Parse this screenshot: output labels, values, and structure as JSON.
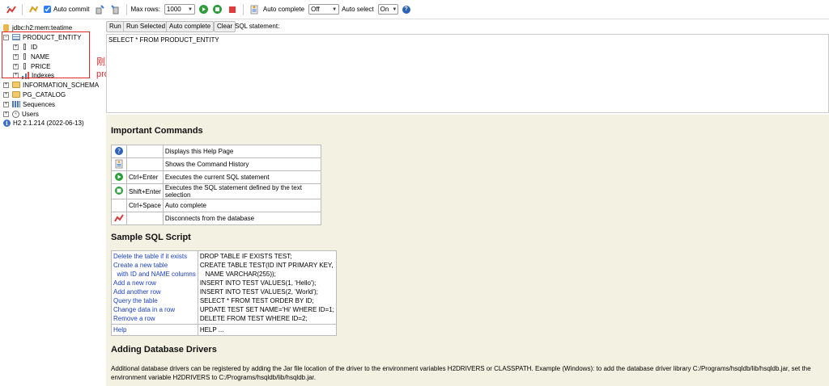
{
  "toolbar": {
    "auto_commit_label": "Auto commit",
    "max_rows_label": "Max rows:",
    "max_rows_value": "1000",
    "auto_complete_label": "Auto complete",
    "auto_complete_value": "Off",
    "auto_select_label": "Auto select",
    "auto_select_value": "On"
  },
  "tree": {
    "connection": "jdbc:h2:mem:teatime",
    "table": "PRODUCT_ENTITY",
    "columns": [
      "ID",
      "NAME",
      "PRICE"
    ],
    "indexes": "Indexes",
    "schemas": [
      "INFORMATION_SCHEMA",
      "PG_CATALOG"
    ],
    "sequences": "Sequences",
    "users": "Users",
    "version": "H2 2.1.214 (2022-06-13)"
  },
  "annotation": {
    "line1": "刚建立的",
    "line2": "product_entity"
  },
  "sql": {
    "buttons": [
      "Run",
      "Run Selected",
      "Auto complete",
      "Clear"
    ],
    "statement_label": "SQL statement:",
    "text": "SELECT * FROM PRODUCT_ENTITY"
  },
  "help": {
    "important_title": "Important Commands",
    "commands": [
      {
        "icon": "help-icon",
        "shortcut": "",
        "desc": "Displays this Help Page"
      },
      {
        "icon": "history-icon",
        "shortcut": "",
        "desc": "Shows the Command History"
      },
      {
        "icon": "run-icon",
        "shortcut": "Ctrl+Enter",
        "desc": "Executes the current SQL statement"
      },
      {
        "icon": "run-selected-icon",
        "shortcut": "Shift+Enter",
        "desc": "Executes the SQL statement defined by the text selection"
      },
      {
        "icon": "",
        "shortcut": "Ctrl+Space",
        "desc": "Auto complete"
      },
      {
        "icon": "disconnect-icon",
        "shortcut": "",
        "desc": "Disconnects from the database"
      }
    ],
    "sample_title": "Sample SQL Script",
    "sample": [
      {
        "link": "Delete the table if it exists",
        "code": "DROP TABLE IF EXISTS TEST;"
      },
      {
        "link": "Create a new table",
        "code": "CREATE TABLE TEST(ID INT PRIMARY KEY,"
      },
      {
        "link": "  with ID and NAME columns",
        "code": "   NAME VARCHAR(255));"
      },
      {
        "link": "Add a new row",
        "code": "INSERT INTO TEST VALUES(1, 'Hello');"
      },
      {
        "link": "Add another row",
        "code": "INSERT INTO TEST VALUES(2, 'World');"
      },
      {
        "link": "Query the table",
        "code": "SELECT * FROM TEST ORDER BY ID;"
      },
      {
        "link": "Change data in a row",
        "code": "UPDATE TEST SET NAME='Hi' WHERE ID=1;"
      },
      {
        "link": "Remove a row",
        "code": "DELETE FROM TEST WHERE ID=2;"
      }
    ],
    "sample_help_link": "Help",
    "sample_help_code": "HELP ...",
    "drivers_title": "Adding Database Drivers",
    "drivers_text": "Additional database drivers can be registered by adding the Jar file location of the driver to the environment variables H2DRIVERS or CLASSPATH. Example (Windows): to add the database driver library C:/Programs/hsqldb/lib/hsqldb.jar, set the environment variable H2DRIVERS to C:/Programs/hsqldb/lib/hsqldb.jar."
  }
}
